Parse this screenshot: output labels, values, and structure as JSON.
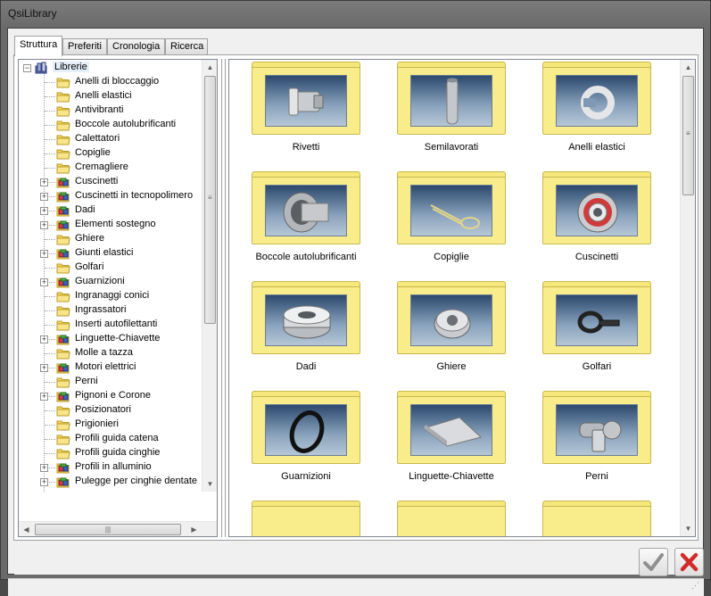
{
  "window": {
    "title": "QsiLibrary"
  },
  "tabs": [
    {
      "label": "Struttura",
      "active": true
    },
    {
      "label": "Preferiti",
      "active": false
    },
    {
      "label": "Cronologia",
      "active": false
    },
    {
      "label": "Ricerca",
      "active": false
    }
  ],
  "tree": {
    "root_label": "Librerie",
    "root_icon": "library-icon",
    "items": [
      {
        "label": "Anelli di bloccaggio",
        "expandable": false,
        "icon": "folder-icon"
      },
      {
        "label": "Anelli elastici",
        "expandable": false,
        "icon": "folder-icon"
      },
      {
        "label": "Antivibranti",
        "expandable": false,
        "icon": "folder-icon"
      },
      {
        "label": "Boccole autolubrificanti",
        "expandable": false,
        "icon": "folder-icon"
      },
      {
        "label": "Calettatori",
        "expandable": false,
        "icon": "folder-icon"
      },
      {
        "label": "Copiglie",
        "expandable": false,
        "icon": "folder-icon"
      },
      {
        "label": "Cremagliere",
        "expandable": false,
        "icon": "folder-icon"
      },
      {
        "label": "Cuscinetti",
        "expandable": true,
        "icon": "library-cube-icon"
      },
      {
        "label": "Cuscinetti in tecnopolimero",
        "expandable": true,
        "icon": "library-cube-icon"
      },
      {
        "label": "Dadi",
        "expandable": true,
        "icon": "library-cube-icon"
      },
      {
        "label": "Elementi sostegno",
        "expandable": true,
        "icon": "library-cube-icon"
      },
      {
        "label": "Ghiere",
        "expandable": false,
        "icon": "folder-icon"
      },
      {
        "label": "Giunti elastici",
        "expandable": true,
        "icon": "library-cube-icon"
      },
      {
        "label": "Golfari",
        "expandable": false,
        "icon": "folder-icon"
      },
      {
        "label": "Guarnizioni",
        "expandable": true,
        "icon": "library-cube-icon"
      },
      {
        "label": "Ingranaggi conici",
        "expandable": false,
        "icon": "folder-icon"
      },
      {
        "label": "Ingrassatori",
        "expandable": false,
        "icon": "folder-icon"
      },
      {
        "label": "Inserti autofilettanti",
        "expandable": false,
        "icon": "folder-icon"
      },
      {
        "label": "Linguette-Chiavette",
        "expandable": true,
        "icon": "library-cube-icon"
      },
      {
        "label": "Molle a tazza",
        "expandable": false,
        "icon": "folder-icon"
      },
      {
        "label": "Motori elettrici",
        "expandable": true,
        "icon": "library-cube-icon"
      },
      {
        "label": "Perni",
        "expandable": false,
        "icon": "folder-icon"
      },
      {
        "label": "Pignoni e Corone",
        "expandable": true,
        "icon": "library-cube-icon"
      },
      {
        "label": "Posizionatori",
        "expandable": false,
        "icon": "folder-icon"
      },
      {
        "label": "Prigionieri",
        "expandable": false,
        "icon": "folder-icon"
      },
      {
        "label": "Profili guida catena",
        "expandable": false,
        "icon": "folder-icon"
      },
      {
        "label": "Profili guida cinghie",
        "expandable": false,
        "icon": "folder-icon"
      },
      {
        "label": "Profili in alluminio",
        "expandable": true,
        "icon": "library-cube-icon"
      },
      {
        "label": "Pulegge per cinghie dentate",
        "expandable": true,
        "icon": "library-cube-icon"
      }
    ]
  },
  "grid": {
    "folders": [
      {
        "label": "Rivetti",
        "thumbnail": "rivet-part"
      },
      {
        "label": "Semilavorati",
        "thumbnail": "rod-part"
      },
      {
        "label": "Anelli elastici",
        "thumbnail": "snap-ring-part"
      },
      {
        "label": "Boccole autolubrificanti",
        "thumbnail": "bushing-part"
      },
      {
        "label": "Copiglie",
        "thumbnail": "cotter-pin-part"
      },
      {
        "label": "Cuscinetti",
        "thumbnail": "bearing-part"
      },
      {
        "label": "Dadi",
        "thumbnail": "knurled-nut-part"
      },
      {
        "label": "Ghiere",
        "thumbnail": "ring-nut-part"
      },
      {
        "label": "Golfari",
        "thumbnail": "eyebolt-part"
      },
      {
        "label": "Guarnizioni",
        "thumbnail": "o-ring-part"
      },
      {
        "label": "Linguette-Chiavette",
        "thumbnail": "key-part"
      },
      {
        "label": "Perni",
        "thumbnail": "pin-part"
      }
    ]
  },
  "buttons": {
    "ok_icon": "checkmark-icon",
    "cancel_icon": "x-icon"
  },
  "colors": {
    "folder": "#f9ec8a",
    "ok": "#9a9a9a",
    "cancel": "#d22a2a"
  }
}
